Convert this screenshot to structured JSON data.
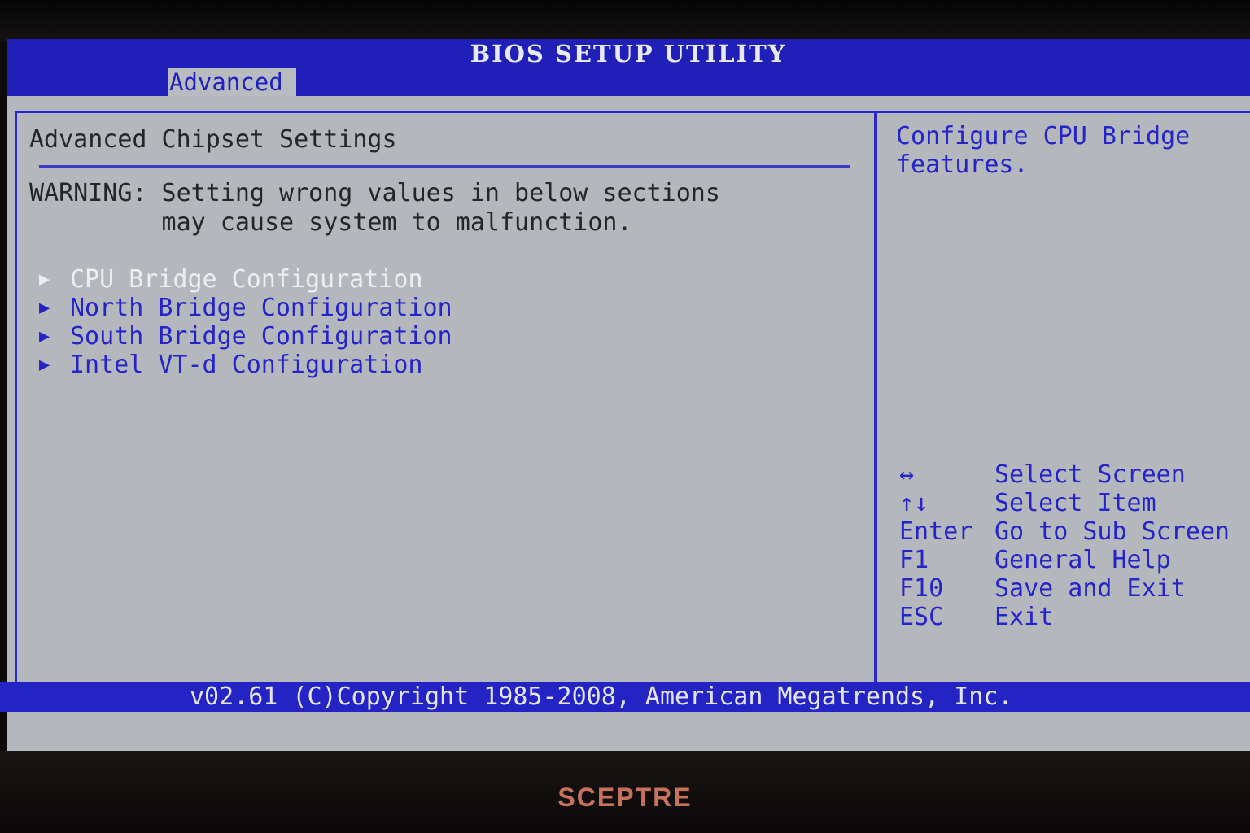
{
  "window": {
    "title": "BIOS SETUP UTILITY"
  },
  "tabs": [
    {
      "label": "Advanced"
    }
  ],
  "main": {
    "heading": "Advanced Chipset Settings",
    "warning_line1": "WARNING: Setting wrong values in below sections",
    "warning_line2": "         may cause system to malfunction.",
    "menu_items": [
      {
        "label": "CPU Bridge Configuration"
      },
      {
        "label": "North Bridge Configuration"
      },
      {
        "label": "South Bridge Configuration"
      },
      {
        "label": "Intel VT-d Configuration"
      }
    ],
    "selected_index": 0
  },
  "help": {
    "line1": "Configure CPU Bridge",
    "line2": "features."
  },
  "keys": [
    {
      "key": "↔",
      "action": "Select Screen"
    },
    {
      "key": "↑↓",
      "action": "Select Item"
    },
    {
      "key": "Enter",
      "action": "Go to Sub Screen"
    },
    {
      "key": "F1",
      "action": "General Help"
    },
    {
      "key": "F10",
      "action": "Save and Exit"
    },
    {
      "key": "ESC",
      "action": "Exit"
    }
  ],
  "footer": {
    "text": "v02.61 (C)Copyright 1985-2008, American Megatrends, Inc."
  },
  "bezel": {
    "brand": "SCEPTRE"
  },
  "colors": {
    "accent": "#2020b8",
    "background": "#b4b8bc",
    "highlight": "#eceef2"
  },
  "icons": {
    "menu_arrow": "triangle-right-icon"
  }
}
